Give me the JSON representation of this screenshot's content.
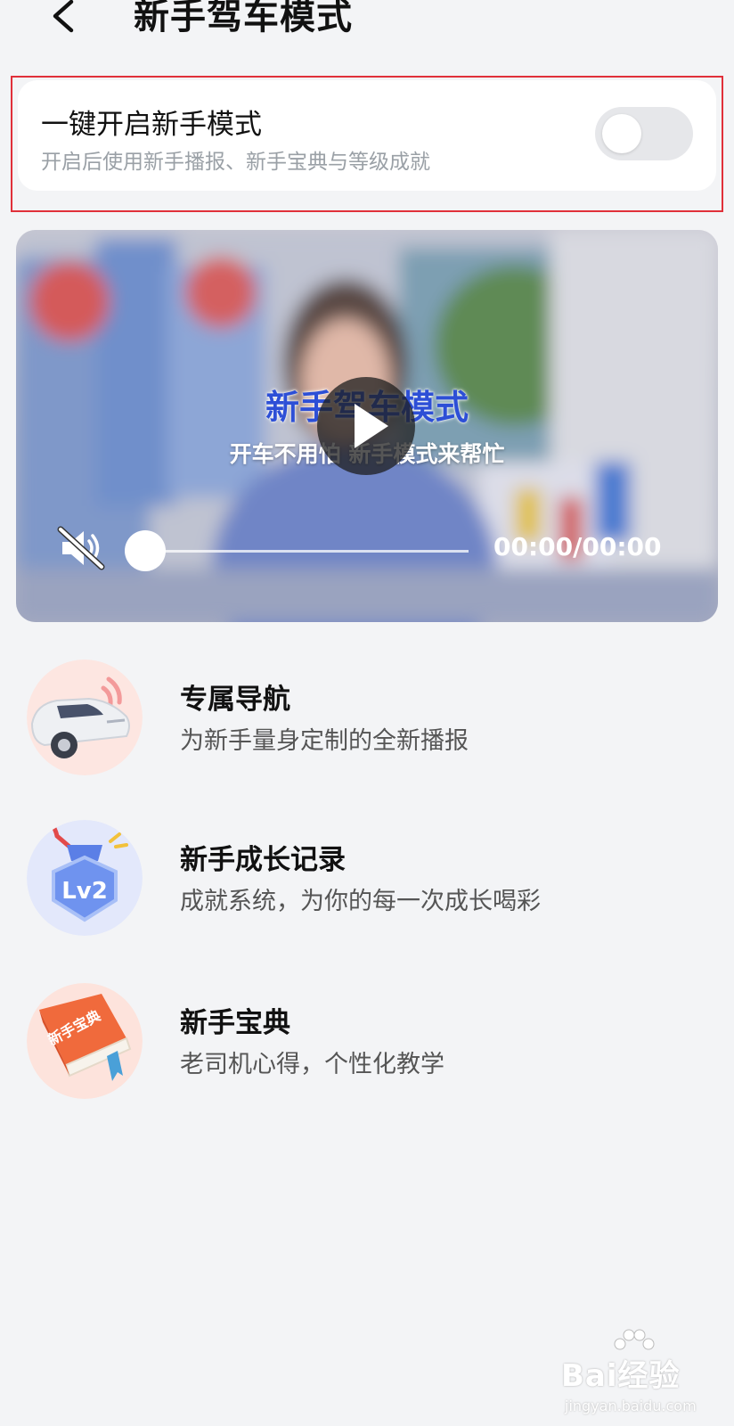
{
  "header": {
    "title": "新手驾车模式"
  },
  "toggle_card": {
    "title": "一键开启新手模式",
    "subtitle": "开启后使用新手播报、新手宝典与等级成就",
    "enabled": false
  },
  "video": {
    "title": "新手驾车模式",
    "subtitle": "开车不用怕 新手模式来帮忙",
    "time": "00:00/00:00",
    "progress": 0,
    "muted": true
  },
  "features": [
    {
      "title": "专属导航",
      "subtitle": "为新手量身定制的全新播报",
      "icon": "car-icon"
    },
    {
      "title": "新手成长记录",
      "subtitle": "成就系统，为你的每一次成长喝彩",
      "icon": "level-medal-icon",
      "badge": "Lv2"
    },
    {
      "title": "新手宝典",
      "subtitle": "老司机心得，个性化教学",
      "icon": "book-icon",
      "book_label": "新手宝典"
    }
  ],
  "watermark": {
    "text": "Bai经验",
    "sub": "jingyan.baidu.com"
  },
  "colors": {
    "accent_blue": "#2d4fd6",
    "highlight_red": "#e0303a",
    "background": "#f3f4f6"
  }
}
